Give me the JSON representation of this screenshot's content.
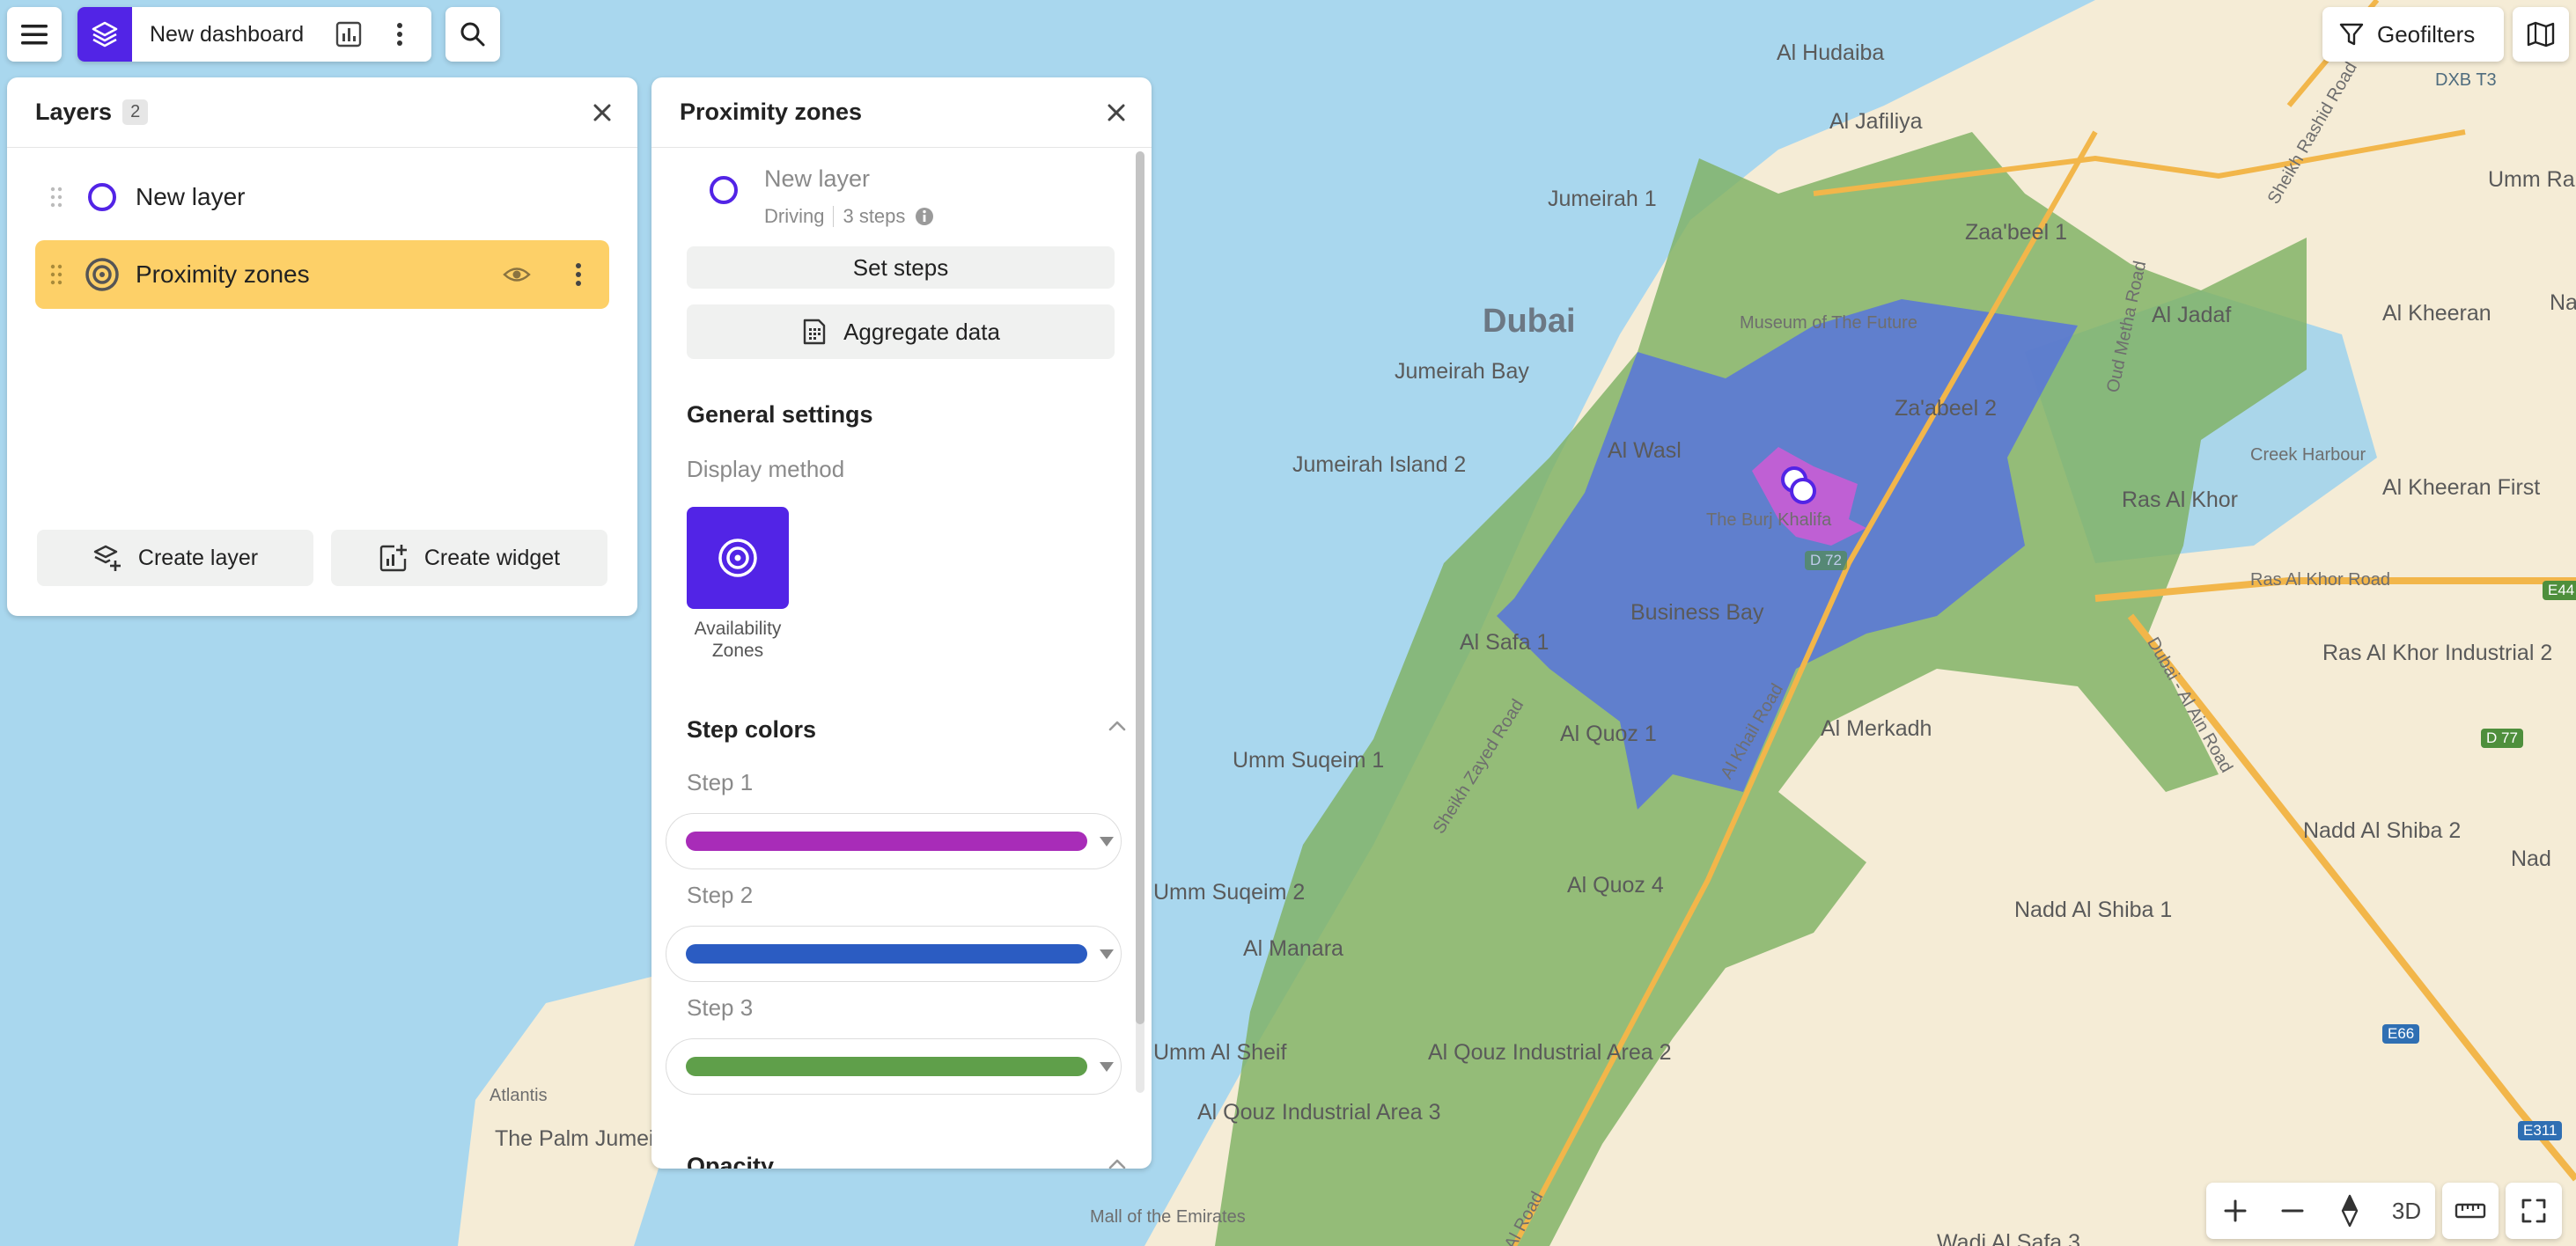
{
  "topbar": {
    "dashboard_title": "New dashboard",
    "geofilters_label": "Geofilters"
  },
  "layers_panel": {
    "title": "Layers",
    "count": "2",
    "items": [
      {
        "label": "New layer"
      },
      {
        "label": "Proximity zones"
      }
    ],
    "create_layer_label": "Create layer",
    "create_widget_label": "Create widget"
  },
  "proximity_panel": {
    "title": "Proximity zones",
    "source_layer": {
      "name": "New layer",
      "mode": "Driving",
      "steps": "3 steps"
    },
    "set_steps_label": "Set steps",
    "aggregate_label": "Aggregate data",
    "general_settings_title": "General settings",
    "display_method_label": "Display method",
    "display_method_value": "Availability Zones",
    "step_colors_title": "Step colors",
    "steps": [
      {
        "label": "Step 1",
        "color": "#a82cb8"
      },
      {
        "label": "Step 2",
        "color": "#2b5cc2"
      },
      {
        "label": "Step 3",
        "color": "#5f9f4a"
      }
    ],
    "opacity_title": "Opacity"
  },
  "map_controls": {
    "label_3d": "3D"
  },
  "map_labels": [
    {
      "text": "Al Hudaiba",
      "cls": "map-label"
    },
    {
      "text": "Al Jafiliya",
      "cls": "map-label"
    },
    {
      "text": "Jumeirah 1",
      "cls": "map-label"
    },
    {
      "text": "Dubai",
      "cls": "map-label big"
    },
    {
      "text": "Jumeirah Bay",
      "cls": "map-label"
    },
    {
      "text": "Jumeirah Island 2",
      "cls": "map-label"
    },
    {
      "text": "Zaa'beel 1",
      "cls": "map-label"
    },
    {
      "text": "Museum of The Future",
      "cls": "map-label small"
    },
    {
      "text": "Za'abeel 2",
      "cls": "map-label"
    },
    {
      "text": "Al Wasl",
      "cls": "map-label"
    },
    {
      "text": "The Burj Khalifa",
      "cls": "map-label small"
    },
    {
      "text": "Business Bay",
      "cls": "map-label"
    },
    {
      "text": "Al Safa 1",
      "cls": "map-label"
    },
    {
      "text": "Al Quoz 1",
      "cls": "map-label"
    },
    {
      "text": "Umm Suqeim 1",
      "cls": "map-label"
    },
    {
      "text": "Al Merkadh",
      "cls": "map-label"
    },
    {
      "text": "Umm Suqeim 2",
      "cls": "map-label"
    },
    {
      "text": "Al Quoz 4",
      "cls": "map-label"
    },
    {
      "text": "Al Manara",
      "cls": "map-label"
    },
    {
      "text": "Umm Al Sheif",
      "cls": "map-label"
    },
    {
      "text": "Al Qouz Industrial Area 2",
      "cls": "map-label"
    },
    {
      "text": "Al Qouz Industrial Area 3",
      "cls": "map-label"
    },
    {
      "text": "Mall of the Emirates",
      "cls": "map-label small"
    },
    {
      "text": "Atlantis",
      "cls": "map-label small"
    },
    {
      "text": "The Palm Jumeirah",
      "cls": "map-label"
    },
    {
      "text": "Creek Harbour",
      "cls": "map-label small"
    },
    {
      "text": "Al Kheeran",
      "cls": "map-label"
    },
    {
      "text": "Al Kheeran First",
      "cls": "map-label"
    },
    {
      "text": "Ras Al Khor",
      "cls": "map-label"
    },
    {
      "text": "Ras Al Khor Road",
      "cls": "map-label small"
    },
    {
      "text": "Ras Al Khor Industrial 2",
      "cls": "map-label"
    },
    {
      "text": "Nadd Al Shiba 2",
      "cls": "map-label"
    },
    {
      "text": "Nadd Al Shiba 1",
      "cls": "map-label"
    },
    {
      "text": "Nad",
      "cls": "map-label"
    },
    {
      "text": "Umm Ramo",
      "cls": "map-label"
    },
    {
      "text": "DXB T3",
      "cls": "map-label small water"
    },
    {
      "text": "Al Jadaf",
      "cls": "map-label"
    },
    {
      "text": "Wadi Al Safa 3",
      "cls": "map-label"
    },
    {
      "text": "Sheikh Rashid Road",
      "cls": "map-label small"
    },
    {
      "text": "Sheikh Zayed Road",
      "cls": "map-label small"
    },
    {
      "text": "Al Khail Road",
      "cls": "map-label small"
    },
    {
      "text": "Oud Metha Road",
      "cls": "map-label small"
    },
    {
      "text": "Dubai - Al Ain Road",
      "cls": "map-label small"
    },
    {
      "text": "Al Road",
      "cls": "map-label small"
    },
    {
      "text": "Na",
      "cls": "map-label"
    }
  ],
  "map_shields": [
    {
      "text": "E44",
      "cls": "shield green"
    },
    {
      "text": "D 77",
      "cls": "shield green"
    },
    {
      "text": "E66",
      "cls": "shield blue"
    },
    {
      "text": "E311",
      "cls": "shield blue"
    },
    {
      "text": "D 72",
      "cls": "shield green"
    }
  ]
}
